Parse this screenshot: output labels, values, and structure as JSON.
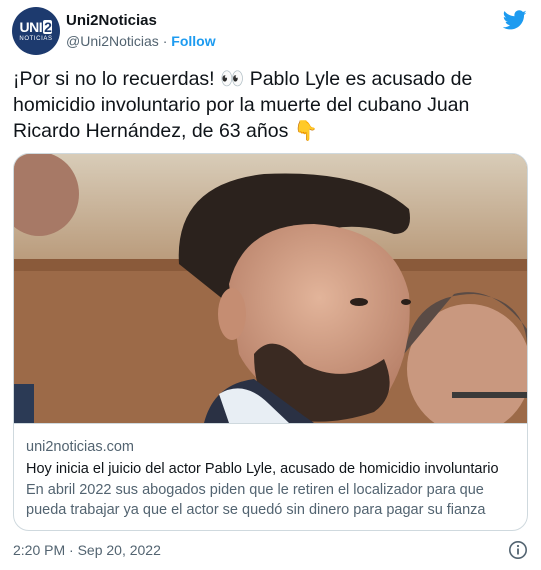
{
  "author": {
    "avatar_text_main": "UNI",
    "avatar_text_badge": "2",
    "avatar_text_sub": "NOTICIAS",
    "name": "Uni2Noticias",
    "handle": "@Uni2Noticias",
    "separator": "·",
    "follow_label": "Follow"
  },
  "tweet": {
    "text": "¡Por si no lo recuerdas! 👀 Pablo Lyle es acusado de homicidio involuntario por la muerte del cubano Juan Ricardo Hernández, de 63 años 👇"
  },
  "card": {
    "domain": "uni2noticias.com",
    "title": "Hoy inicia el juicio del actor Pablo Lyle, acusado de homicidio involuntario",
    "description": "En abril 2022 sus abogados piden que le retiren el localizador para que pueda trabajar ya que el actor se quedó sin dinero para pagar su fianza"
  },
  "footer": {
    "timestamp": "2:20 PM · Sep 20, 2022"
  },
  "icons": {
    "brand": "twitter-bird-icon",
    "info": "info-icon"
  },
  "colors": {
    "accent": "#1d9bf0",
    "avatar_bg": "#1d3a6e",
    "secondary_text": "#536471",
    "border": "#cfd9de"
  }
}
